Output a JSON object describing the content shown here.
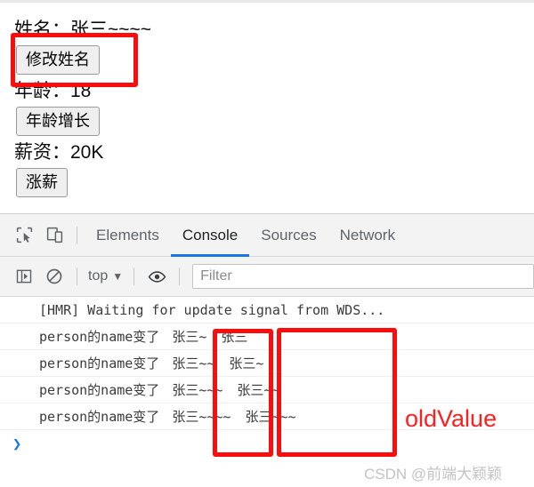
{
  "page": {
    "name_label": "姓名：张三~~~~",
    "change_name_button": "修改姓名",
    "age_label": "年龄：18",
    "increase_age_button": "年龄增长",
    "salary_label": "薪资：20K",
    "raise_salary_button": "涨薪"
  },
  "devtools": {
    "icons": {
      "inspect": "inspect-cursor-icon",
      "device": "device-toolbar-icon",
      "sidebar": "console-sidebar-icon",
      "clear": "clear-console-icon",
      "eye": "live-expression-eye-icon",
      "chevron": "▼"
    },
    "tabs": [
      {
        "label": "Elements",
        "active": false
      },
      {
        "label": "Console",
        "active": true
      },
      {
        "label": "Sources",
        "active": false
      },
      {
        "label": "Network",
        "active": false
      }
    ],
    "filterbar": {
      "context": "top",
      "filter_placeholder": "Filter",
      "filter_value": ""
    },
    "console_rows": [
      {
        "text": "[HMR] Waiting for update signal from WDS...",
        "new_value": "",
        "old_value": ""
      },
      {
        "text": "person的name变了",
        "new_value": "张三~",
        "old_value": "张三"
      },
      {
        "text": "person的name变了",
        "new_value": "张三~~",
        "old_value": "张三~"
      },
      {
        "text": "person的name变了",
        "new_value": "张三~~~",
        "old_value": "张三~~"
      },
      {
        "text": "person的name变了",
        "new_value": "张三~~~~",
        "old_value": "张三~~~"
      }
    ],
    "prompt_symbol": "❯"
  },
  "annotations": {
    "old_value_label": "oldValue",
    "highlight_color": "#fc0d0d"
  },
  "watermark": "CSDN @前端大颖颖"
}
